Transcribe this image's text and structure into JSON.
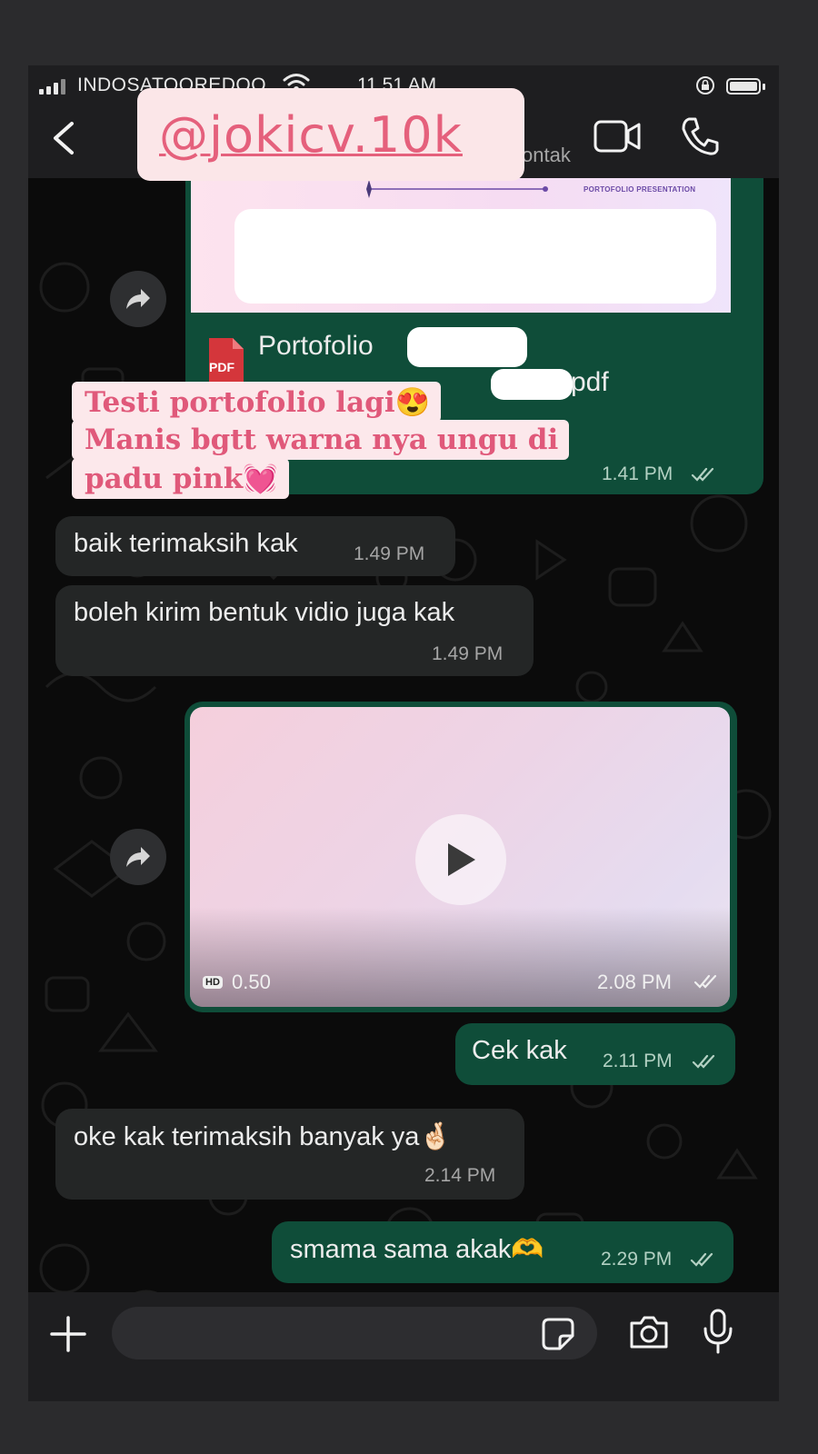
{
  "status_bar": {
    "carrier": "INDOSATOOREDOO",
    "time": "11.51 AM"
  },
  "header": {
    "contact_subtitle": "kontak"
  },
  "overlay": {
    "watermark": "@jokicv.10k",
    "caption_line1": "Testi portofolio lagi😍",
    "caption_line2": "Manis bgtt warna nya ungu di",
    "caption_line3": "padu pink💓"
  },
  "messages": {
    "document": {
      "preview_label": "PORTOFOLIO PRESENTATION",
      "file_name": "Portofolio",
      "file_ext": "pdf",
      "icon_label": "PDF",
      "time": "1.41 PM"
    },
    "m1": {
      "text": "baik terimaksih kak",
      "time": "1.49 PM"
    },
    "m2": {
      "text": "boleh kirim bentuk vidio juga kak",
      "time": "1.49 PM"
    },
    "video": {
      "hd": "HD",
      "duration": "0.50",
      "time": "2.08 PM"
    },
    "m3": {
      "text": "Cek kak",
      "time": "2.11 PM"
    },
    "m4": {
      "text": "oke kak terimaksih banyak ya🤞🏻",
      "time": "2.14 PM"
    },
    "m5": {
      "text": "smama sama akak🫶",
      "time": "2.29 PM"
    }
  },
  "colors": {
    "incoming_bubble": "#242626",
    "outgoing_bubble": "#0f4d39",
    "chat_background": "#0b0b0b",
    "watermark_text": "#e5607c"
  },
  "icons": [
    "back-chevron-icon",
    "video-call-icon",
    "phone-call-icon",
    "forward-icon",
    "pdf-icon",
    "play-icon",
    "double-check-icon",
    "plus-icon",
    "sticker-icon",
    "camera-icon",
    "mic-icon",
    "wifi-icon",
    "signal-icon",
    "battery-icon",
    "rotation-lock-icon"
  ]
}
